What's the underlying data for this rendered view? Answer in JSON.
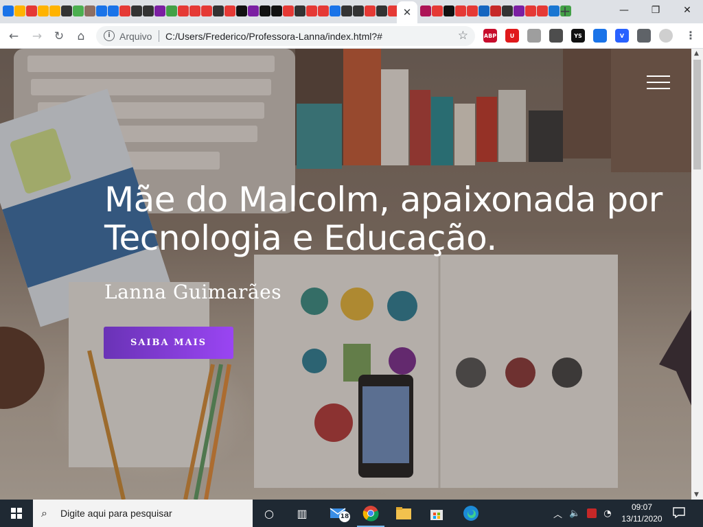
{
  "browser": {
    "tab_close_label": "✕",
    "new_tab_label": "+",
    "window": {
      "minimize": "—",
      "restore": "❐",
      "close": "✕"
    },
    "nav": {
      "back": "←",
      "forward": "→",
      "reload": "↻",
      "home": "⌂"
    },
    "address": {
      "info_icon": "i",
      "scheme_label": "Arquivo",
      "url": "C:/Users/Frederico/Professora-Lanna/index.html?#"
    },
    "bookmark_icon": "☆",
    "menu_icon": "⋮",
    "extensions": [
      {
        "name": "adblock-icon",
        "label": "ABP",
        "color": "#c70d2c"
      },
      {
        "name": "ublock-icon",
        "label": "U",
        "color": "#e0191b"
      },
      {
        "name": "pdf-icon",
        "label": "",
        "color": "#9e9e9e"
      },
      {
        "name": "timer-icon",
        "label": "",
        "color": "#4d4d4d"
      },
      {
        "name": "ys-icon",
        "label": "YS",
        "color": "#111111"
      },
      {
        "name": "expand-icon",
        "label": "",
        "color": "#1a73e8"
      },
      {
        "name": "v-icon",
        "label": "V",
        "color": "#2962ff"
      },
      {
        "name": "puzzle-icon",
        "label": "",
        "color": "#5f6368"
      },
      {
        "name": "profile-avatar",
        "label": "",
        "color": "#cfcfcf"
      }
    ]
  },
  "tab_favicons_left": [
    "#1a73e8",
    "#ffb300",
    "#e53935",
    "#ffb300",
    "#ffb300",
    "#333333",
    "#4caf50",
    "#8d6e63",
    "#1a73e8",
    "#1a73e8",
    "#e53935",
    "#333333",
    "#333333",
    "#7b1fa2",
    "#43a047",
    "#e53935",
    "#e53935",
    "#e53935",
    "#333333",
    "#e53935",
    "#111111",
    "#7b1fa2",
    "#111111",
    "#111111",
    "#e53935",
    "#333333",
    "#e53935",
    "#e53935",
    "#1a73e8",
    "#333333",
    "#333333",
    "#e53935",
    "#333333",
    "#e53935"
  ],
  "tab_favicons_right": [
    "#ad1457",
    "#e53935",
    "#111111",
    "#e53935",
    "#e53935",
    "#1565c0",
    "#c62828",
    "#333333",
    "#7b1fa2",
    "#e53935",
    "#e53935",
    "#1976d2",
    "#43a047"
  ],
  "page": {
    "hero_title": "Mãe do Malcolm, apaixonada por Tecnologia e Educação.",
    "hero_subtitle": "Lanna Guimarães",
    "cta_label": "SAIBA MAIS",
    "brand_gradient": [
      "#6a33b6",
      "#9a45f3"
    ]
  },
  "taskbar": {
    "search_placeholder": "Digite aqui para pesquisar",
    "mail_badge": "18",
    "time": "09:07",
    "date": "13/11/2020"
  }
}
